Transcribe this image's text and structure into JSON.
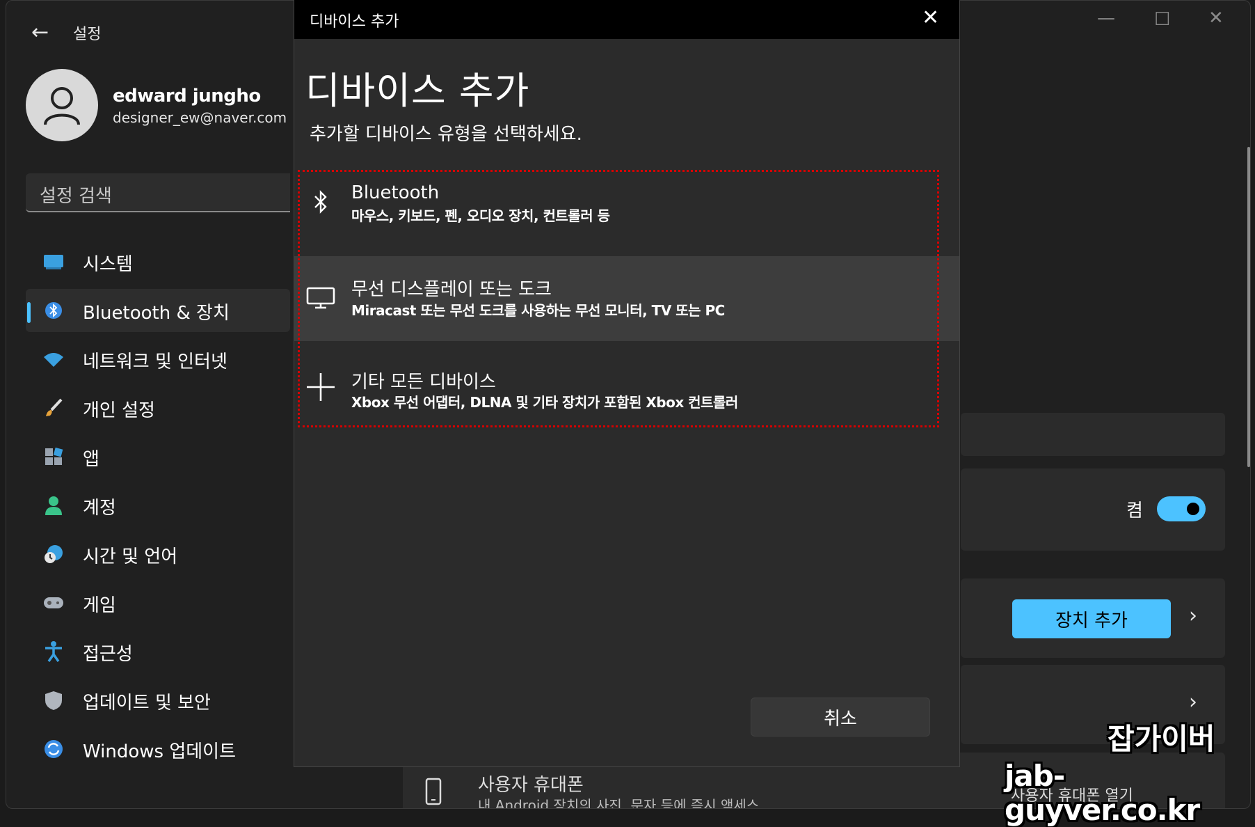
{
  "settings": {
    "app_title": "설정",
    "user": {
      "name": "edward jungho",
      "email": "designer_ew@naver.com"
    },
    "search": {
      "placeholder": "설정 검색"
    },
    "nav": [
      {
        "label": "시스템",
        "icon": "monitor-icon"
      },
      {
        "label": "Bluetooth & 장치",
        "icon": "bluetooth-icon",
        "active": true
      },
      {
        "label": "네트워크 및 인터넷",
        "icon": "wifi-icon"
      },
      {
        "label": "개인 설정",
        "icon": "brush-icon"
      },
      {
        "label": "앱",
        "icon": "apps-icon"
      },
      {
        "label": "계정",
        "icon": "account-icon"
      },
      {
        "label": "시간 및 언어",
        "icon": "clock-globe-icon"
      },
      {
        "label": "게임",
        "icon": "gamepad-icon"
      },
      {
        "label": "접근성",
        "icon": "accessibility-icon"
      },
      {
        "label": "업데이트 및 보안",
        "icon": "shield-icon"
      },
      {
        "label": "Windows 업데이트",
        "icon": "windows-update-icon"
      }
    ],
    "bluetooth_toggle": {
      "label": "켬",
      "on": true
    },
    "add_device_button": "장치 추가",
    "phone": {
      "title": "사용자 휴대폰",
      "desc": "내 Android 장치의 사진, 문자 등에 즉시 액세스",
      "action": "사용자 휴대폰 열기"
    },
    "accent_color": "#4cc2ff"
  },
  "dialog": {
    "titlebar": "디바이스 추가",
    "heading": "디바이스 추가",
    "subtitle": "추가할 디바이스 유형을 선택하세요.",
    "options": [
      {
        "icon": "bluetooth-icon",
        "title": "Bluetooth",
        "desc": "마우스, 키보드, 펜, 오디오 장치, 컨트롤러 등"
      },
      {
        "icon": "display-icon",
        "title": "무선 디스플레이 또는 도크",
        "desc": "Miracast 또는 무선 도크를 사용하는 무선 모니터, TV 또는 PC"
      },
      {
        "icon": "plus-icon",
        "title": "기타 모든 디바이스",
        "desc": "Xbox 무선 어댑터, DLNA 및 기타 장치가 포함된 Xbox 컨트롤러"
      }
    ],
    "cancel_button": "취소",
    "highlight_color": "#d60000"
  },
  "watermark": {
    "line1": "잡가이버",
    "line2": "jab-guyver.co.kr"
  }
}
